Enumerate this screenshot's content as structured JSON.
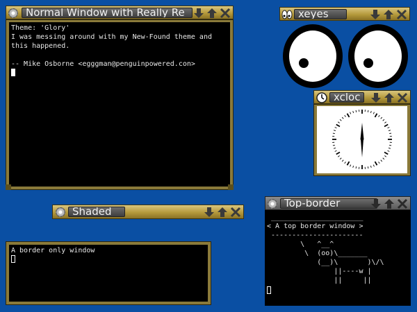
{
  "colors": {
    "desktop": "#0a4fa3",
    "frame": "#b59a3c",
    "terminal_bg": "#000000"
  },
  "windows": {
    "normal": {
      "title": "Normal Window with Really Re",
      "lines": [
        "Theme: 'Glory'",
        "I was messing around with my New-Found theme and",
        "this happened.",
        "",
        "-- Mike Osborne <egggman@penguinpowered.con>"
      ]
    },
    "xeyes": {
      "title": "xeyes"
    },
    "xclock": {
      "title": "xcloc"
    },
    "shaded": {
      "title": "Shaded"
    },
    "topborder": {
      "title": "Top-border",
      "art": [
        " ______________________",
        "< A top border window >",
        " ----------------------",
        "        \\   ^__^",
        "         \\  (oo)\\_______",
        "            (__)\\       )\\/\\",
        "                ||----w |",
        "                ||     ||"
      ]
    },
    "borderonly": {
      "line": "A border only window"
    }
  },
  "icons": {
    "menu": "gear-icon",
    "minimize": "arrow-down-icon",
    "maximize": "arrow-up-icon",
    "close": "close-x-icon",
    "xeyes": "eyes-icon",
    "xclock": "clock-icon"
  }
}
